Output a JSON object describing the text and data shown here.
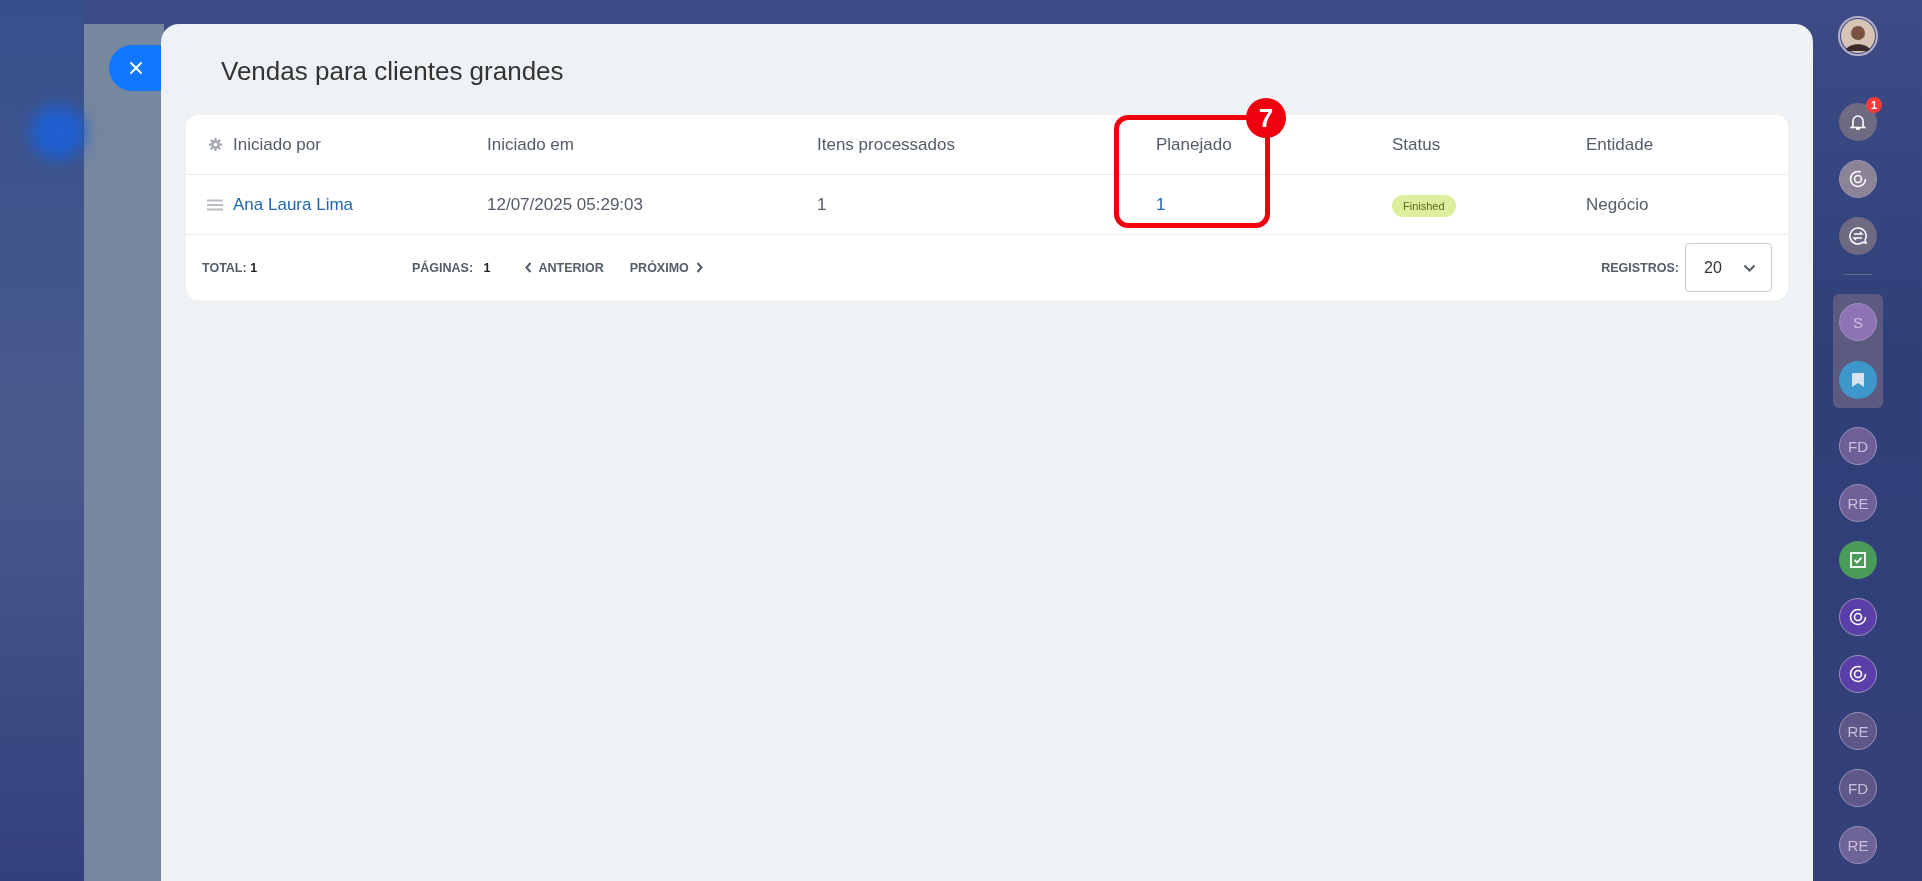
{
  "dialog": {
    "title": "Vendas para clientes grandes"
  },
  "table": {
    "columns": [
      "Iniciado por",
      "Iniciado em",
      "Itens processados",
      "Planejado",
      "Status",
      "Entidade"
    ],
    "rows": [
      {
        "cells": [
          {
            "kind": "link",
            "text": "Ana Laura Lima"
          },
          {
            "kind": "text",
            "text": "12/07/2025 05:29:03"
          },
          {
            "kind": "text",
            "text": "1"
          },
          {
            "kind": "link",
            "text": "1"
          },
          {
            "kind": "status",
            "text": "Finished"
          },
          {
            "kind": "text",
            "text": "Negócio"
          }
        ]
      }
    ]
  },
  "footer": {
    "total_label": "TOTAL:",
    "total": "1",
    "pages_label": "PÁGINAS:",
    "pages": "1",
    "prev": "ANTERIOR",
    "next": "PRÓXIMO",
    "records_label": "REGISTROS:",
    "records": "20"
  },
  "annotation": {
    "label": "7"
  },
  "sidebar": {
    "items": [
      {
        "kind": "avatar"
      },
      {
        "kind": "bell",
        "badge": "1"
      },
      {
        "kind": "swirl",
        "color": "#8a8496"
      },
      {
        "kind": "chat"
      },
      {
        "kind": "divider"
      },
      {
        "kind": "group",
        "children": [
          {
            "kind": "initials",
            "label": "S",
            "color": "#8e74b4"
          },
          {
            "kind": "bookmark",
            "color": "#3d97c9"
          }
        ]
      },
      {
        "kind": "initials",
        "label": "FD",
        "color": "#6e5f98"
      },
      {
        "kind": "initials",
        "label": "RE",
        "color": "#6e5f98"
      },
      {
        "kind": "task",
        "color": "#4a9a5a"
      },
      {
        "kind": "swirl",
        "color": "#5a3fa8"
      },
      {
        "kind": "swirl",
        "color": "#5a3fa8"
      },
      {
        "kind": "initials",
        "label": "RE",
        "color": "#5e5888"
      },
      {
        "kind": "initials",
        "label": "FD",
        "color": "#5e5888"
      },
      {
        "kind": "initials",
        "label": "RE",
        "color": "#6e6498"
      }
    ]
  }
}
